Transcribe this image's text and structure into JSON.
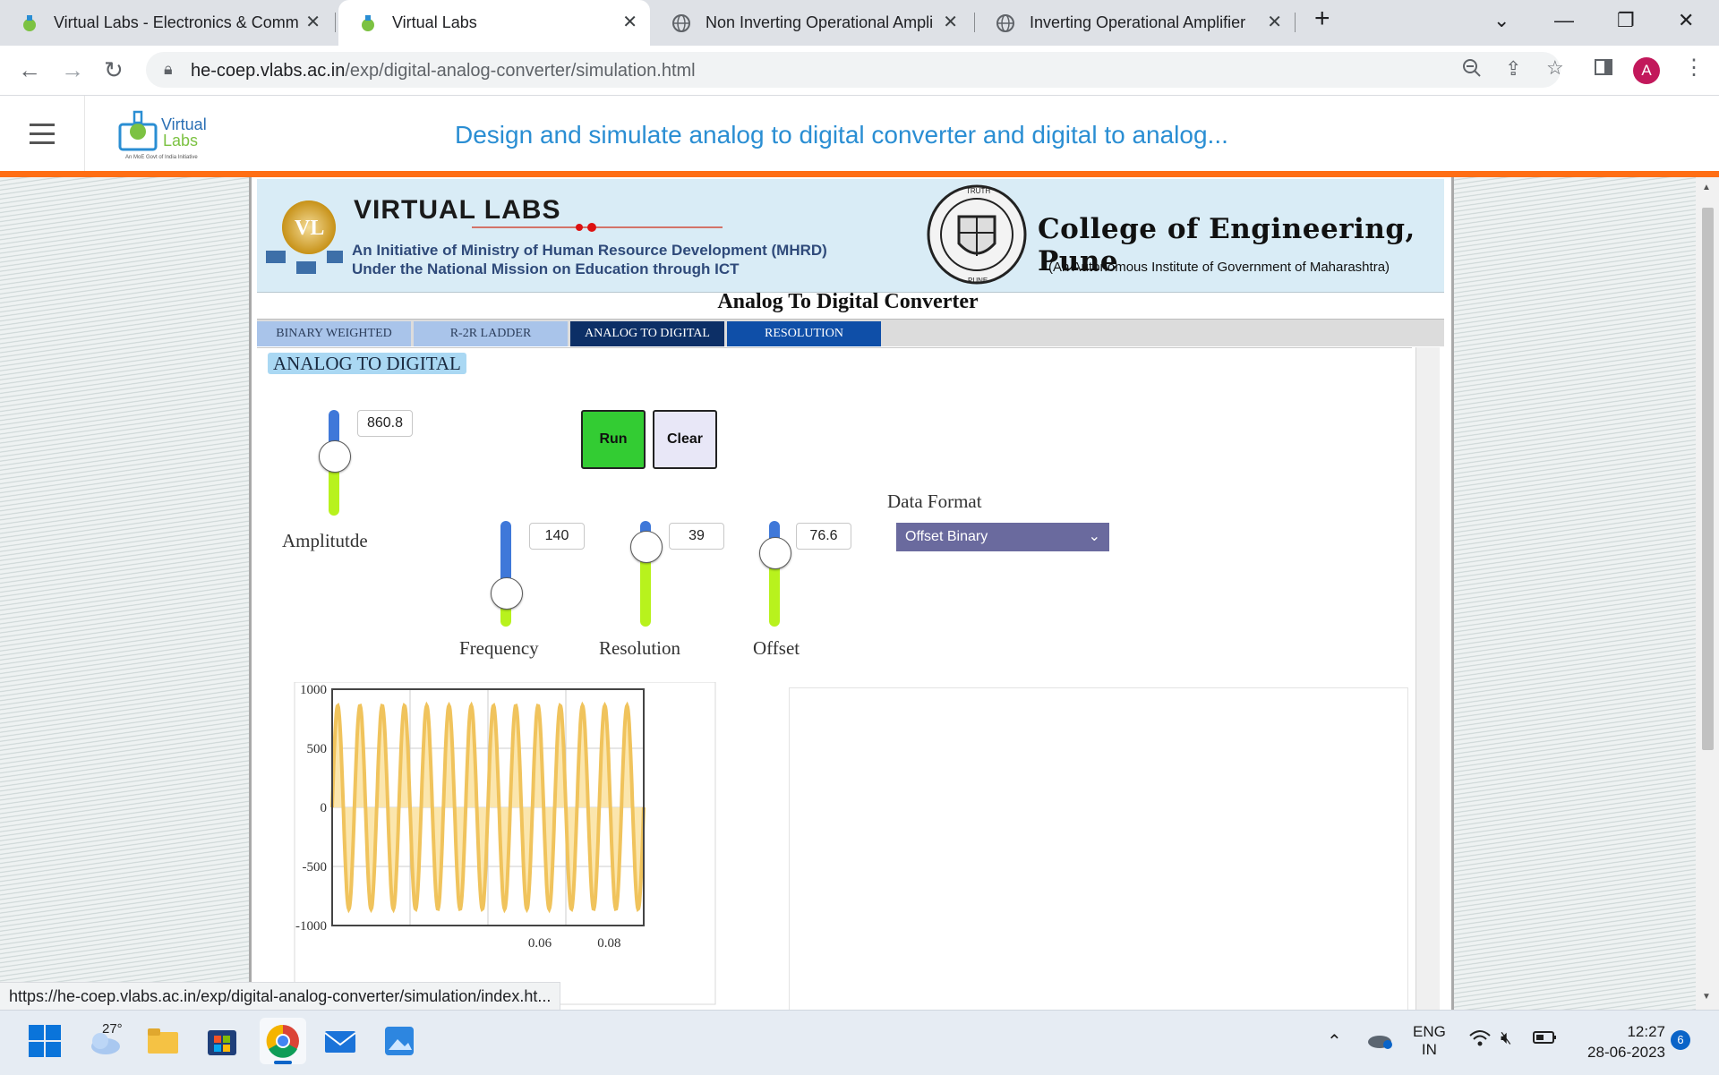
{
  "browser": {
    "tabs": [
      {
        "title": "Virtual Labs - Electronics & Comm",
        "active": false,
        "icon": "vlabs-icon"
      },
      {
        "title": "Virtual Labs",
        "active": true,
        "icon": "vlabs-icon"
      },
      {
        "title": "Non Inverting Operational Ampli",
        "active": false,
        "icon": "globe-icon"
      },
      {
        "title": "Inverting Operational Amplifier",
        "active": false,
        "icon": "globe-icon"
      }
    ],
    "url_host": "he-coep.vlabs.ac.in",
    "url_path": "/exp/digital-analog-converter/simulation.html",
    "profile_initial": "A",
    "status_url": "https://he-coep.vlabs.ac.in/exp/digital-analog-converter/simulation/index.ht..."
  },
  "site": {
    "logo_line1": "Virtual",
    "logo_line2": "Labs",
    "logo_tagline": "An MoE Govt of India Initiative",
    "heading": "Design and simulate analog to digital converter and digital to analog..."
  },
  "banner": {
    "vl_title": "VIRTUAL LABS",
    "initiative_line1": "An Initiative of Ministry of Human Resource Development (MHRD)",
    "initiative_line2": "Under the National Mission on Education through ICT",
    "college": "College of Engineering, Pune",
    "college_sub": "(An Autonomous Institute of Government of Maharashtra)",
    "emblem_text_top": "TRUTH",
    "emblem_text_bottom": "PUNE"
  },
  "simulator": {
    "title": "Analog To Digital Converter",
    "tabs": [
      {
        "label": "BINARY WEIGHTED",
        "state": "inactive"
      },
      {
        "label": "R-2R LADDER",
        "state": "inactive"
      },
      {
        "label": "ANALOG TO DIGITAL",
        "state": "active"
      },
      {
        "label": "RESOLUTION",
        "state": "highlight"
      }
    ],
    "section_label": "ANALOG TO DIGITAL",
    "controls": {
      "amplitude": {
        "label": "Amplitutde",
        "value": "860.8",
        "level": 0.43
      },
      "frequency": {
        "label": "Frequency",
        "value": "140",
        "level": 0.68
      },
      "resolution": {
        "label": "Resolution",
        "value": "39",
        "level": 0.24
      },
      "offset": {
        "label": "Offset",
        "value": "76.6",
        "level": 0.3
      }
    },
    "run_label": "Run",
    "clear_label": "Clear",
    "data_format_label": "Data Format",
    "data_format_value": "Offset Binary"
  },
  "chart_data": {
    "type": "area",
    "ylim": [
      -1000,
      1000
    ],
    "yticks": [
      "1000",
      "500",
      "0",
      "-500",
      "-1000"
    ],
    "xticks": [
      "0.06",
      "0.08"
    ],
    "x_min": 0,
    "x_max": 0.09,
    "amplitude": 860.8,
    "cycles": 14,
    "color": "#f0c35c",
    "fill": "#fbe6ad"
  },
  "taskbar": {
    "weather": "27°",
    "language_line1": "ENG",
    "language_line2": "IN",
    "time": "12:27",
    "date": "28-06-2023",
    "notifications": "6"
  }
}
